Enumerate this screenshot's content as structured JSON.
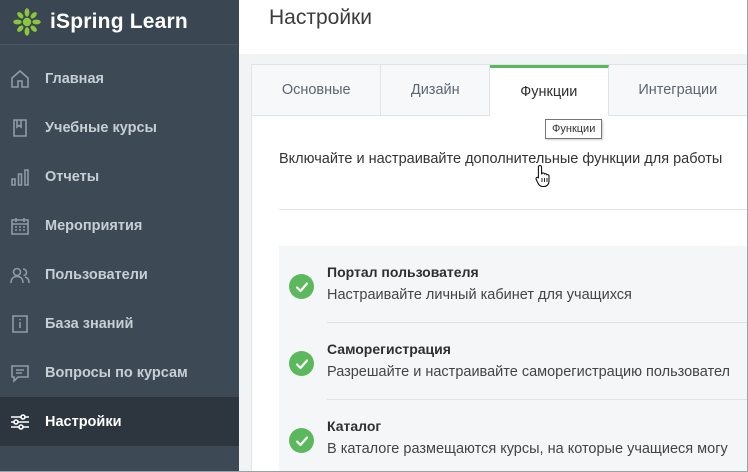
{
  "app": {
    "name": "iSpring Learn",
    "brand_color": "#5cb85c",
    "logo_icon": "ispring-logo-icon"
  },
  "sidebar": {
    "items": [
      {
        "label": "Главная",
        "icon": "home-icon",
        "active": false
      },
      {
        "label": "Учебные курсы",
        "icon": "book-icon",
        "active": false
      },
      {
        "label": "Отчеты",
        "icon": "bar-chart-icon",
        "active": false
      },
      {
        "label": "Мероприятия",
        "icon": "calendar-icon",
        "active": false
      },
      {
        "label": "Пользователи",
        "icon": "users-icon",
        "active": false
      },
      {
        "label": "База знаний",
        "icon": "info-book-icon",
        "active": false
      },
      {
        "label": "Вопросы по курсам",
        "icon": "chat-icon",
        "active": false
      },
      {
        "label": "Настройки",
        "icon": "sliders-icon",
        "active": true
      }
    ]
  },
  "header": {
    "title": "Настройки"
  },
  "tabs": [
    {
      "label": "Основные",
      "active": false
    },
    {
      "label": "Дизайн",
      "active": false
    },
    {
      "label": "Функции",
      "active": true
    },
    {
      "label": "Интеграции",
      "active": false
    }
  ],
  "tooltip": {
    "text": "Функции"
  },
  "content": {
    "intro": "Включайте и настраивайте дополнительные функции для работы",
    "features": [
      {
        "title": "Портал пользователя",
        "desc": "Настраивайте личный кабинет для учащихся",
        "enabled": true
      },
      {
        "title": "Саморегистрация",
        "desc": "Разрешайте и настраивайте саморегистрацию пользовател",
        "enabled": true
      },
      {
        "title": "Каталог",
        "desc": "В каталоге размещаются курсы, на которые учащиеся могу",
        "enabled": true
      }
    ]
  }
}
